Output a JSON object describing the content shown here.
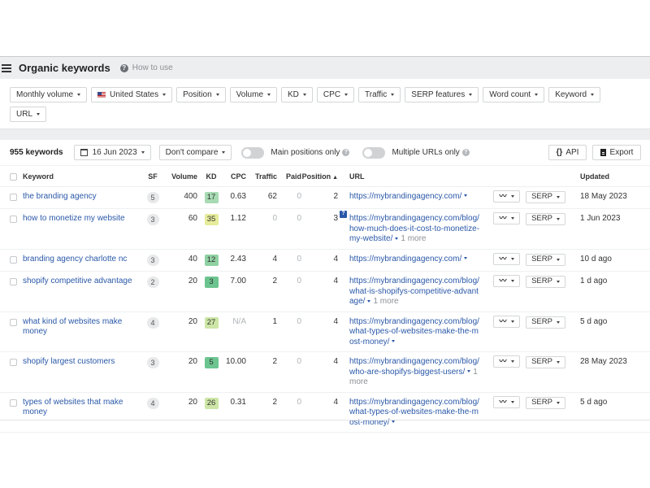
{
  "header": {
    "title": "Organic keywords",
    "help_label": "How to use"
  },
  "filters": [
    {
      "label": "Monthly volume",
      "icon": null
    },
    {
      "label": "United States",
      "icon": "us-flag-icon"
    },
    {
      "label": "Position",
      "icon": null
    },
    {
      "label": "Volume",
      "icon": null
    },
    {
      "label": "KD",
      "icon": null
    },
    {
      "label": "CPC",
      "icon": null
    },
    {
      "label": "Traffic",
      "icon": null
    },
    {
      "label": "SERP features",
      "icon": null
    },
    {
      "label": "Word count",
      "icon": null
    },
    {
      "label": "Keyword",
      "icon": null
    },
    {
      "label": "URL",
      "icon": null
    }
  ],
  "toolbar": {
    "keyword_count": "955 keywords",
    "date": "16 Jun 2023",
    "compare": "Don't compare",
    "main_positions_label": "Main positions only",
    "main_positions_on": false,
    "multiple_urls_label": "Multiple URLs only",
    "multiple_urls_on": false,
    "api_label": "API",
    "export_label": "Export"
  },
  "table": {
    "columns": {
      "keyword": "Keyword",
      "sf": "SF",
      "volume": "Volume",
      "kd": "KD",
      "cpc": "CPC",
      "traffic": "Traffic",
      "paid": "Paid",
      "position": "Position",
      "position_sort": "▲",
      "url": "URL",
      "updated": "Updated"
    },
    "trend_label": "~",
    "serp_label": "SERP",
    "rows": [
      {
        "keyword": "the branding agency",
        "sf": "5",
        "volume": "400",
        "kd": "17",
        "kd_color": "#a8dbb4",
        "cpc": "0.63",
        "cpc_muted": false,
        "traffic": "62",
        "traffic_muted": false,
        "paid": "0",
        "position": "2",
        "has_note": false,
        "url": "https://mybrandingagency.com/",
        "more": "",
        "updated": "18 May 2023"
      },
      {
        "keyword": "how to monetize my website",
        "sf": "3",
        "volume": "60",
        "kd": "35",
        "kd_color": "#e6ec9a",
        "cpc": "1.12",
        "cpc_muted": false,
        "traffic": "0",
        "traffic_muted": true,
        "paid": "0",
        "position": "3",
        "has_note": true,
        "url": "https://mybrandingagency.com/blog/how-much-does-it-cost-to-monetize-my-website/",
        "more": "1 more",
        "updated": "1 Jun 2023"
      },
      {
        "keyword": "branding agency charlotte nc",
        "sf": "3",
        "volume": "40",
        "kd": "12",
        "kd_color": "#8fd1a2",
        "cpc": "2.43",
        "cpc_muted": false,
        "traffic": "4",
        "traffic_muted": false,
        "paid": "0",
        "position": "4",
        "has_note": false,
        "url": "https://mybrandingagency.com/",
        "more": "",
        "updated": "10 d ago"
      },
      {
        "keyword": "shopify competitive advantage",
        "sf": "2",
        "volume": "20",
        "kd": "3",
        "kd_color": "#6cc48f",
        "cpc": "7.00",
        "cpc_muted": false,
        "traffic": "2",
        "traffic_muted": false,
        "paid": "0",
        "position": "4",
        "has_note": false,
        "url": "https://mybrandingagency.com/blog/what-is-shopifys-competitive-advantage/",
        "more": "1 more",
        "updated": "1 d ago"
      },
      {
        "keyword": "what kind of websites make money",
        "sf": "4",
        "volume": "20",
        "kd": "27",
        "kd_color": "#cde6a6",
        "cpc": "N/A",
        "cpc_muted": true,
        "traffic": "1",
        "traffic_muted": false,
        "paid": "0",
        "position": "4",
        "has_note": false,
        "url": "https://mybrandingagency.com/blog/what-types-of-websites-make-the-most-money/",
        "more": "",
        "updated": "5 d ago"
      },
      {
        "keyword": "shopify largest customers",
        "sf": "3",
        "volume": "20",
        "kd": "5",
        "kd_color": "#6cc48f",
        "cpc": "10.00",
        "cpc_muted": false,
        "traffic": "2",
        "traffic_muted": false,
        "paid": "0",
        "position": "4",
        "has_note": false,
        "url": "https://mybrandingagency.com/blog/who-are-shopifys-biggest-users/",
        "more": "1 more",
        "updated": "28 May 2023"
      },
      {
        "keyword": "types of websites that make money",
        "sf": "4",
        "volume": "20",
        "kd": "26",
        "kd_color": "#cde6a6",
        "cpc": "0.31",
        "cpc_muted": false,
        "traffic": "2",
        "traffic_muted": false,
        "paid": "0",
        "position": "4",
        "has_note": false,
        "url": "https://mybrandingagency.com/blog/what-types-of-websites-make-the-most-money/",
        "more": "",
        "updated": "5 d ago"
      }
    ]
  }
}
